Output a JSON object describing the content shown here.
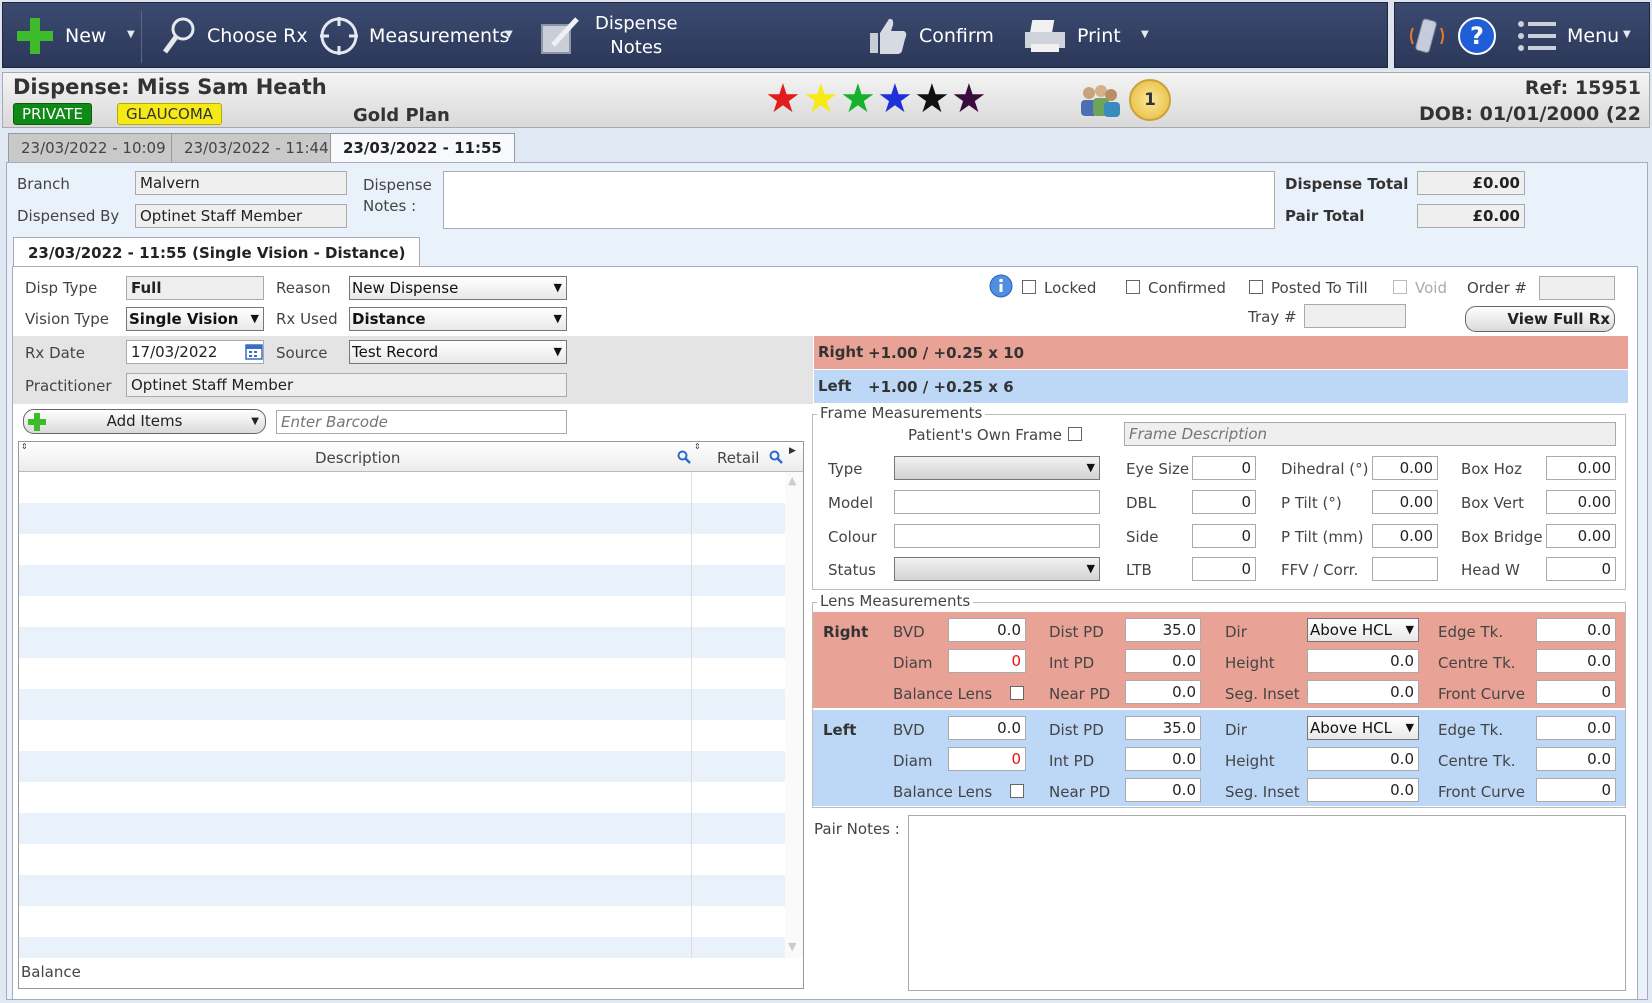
{
  "toolbar": {
    "new_label": "New",
    "choose_rx_label": "Choose Rx",
    "measurements_label": "Measurements",
    "dispense_notes_line1": "Dispense",
    "dispense_notes_line2": "Notes",
    "confirm_label": "Confirm",
    "print_label": "Print",
    "menu_label": "Menu"
  },
  "header": {
    "title": "Dispense: Miss Sam Heath",
    "tag_private": "PRIVATE",
    "tag_glaucoma": "GLAUCOMA",
    "plan": "Gold Plan",
    "badge_count": "1",
    "ref": "Ref: 15951",
    "dob": "DOB: 01/01/2000 (22",
    "star_colors": [
      "#e21b1b",
      "#f5ea16",
      "#17b22c",
      "#1f2fd9",
      "#111111",
      "#3b0b3d"
    ]
  },
  "tabs": [
    "23/03/2022 - 10:09",
    "23/03/2022 - 11:44",
    "23/03/2022 - 11:55"
  ],
  "summary": {
    "branch_label": "Branch",
    "branch_value": "Malvern",
    "dispensed_by_label": "Dispensed By",
    "dispensed_by_value": "Optinet Staff Member",
    "notes_label_1": "Dispense",
    "notes_label_2": "Notes :",
    "dispense_total_label": "Dispense Total",
    "dispense_total_value": "£0.00",
    "pair_total_label": "Pair Total",
    "pair_total_value": "£0.00"
  },
  "pair_tab": "23/03/2022 - 11:55 (Single Vision - Distance)",
  "pair": {
    "disp_type_label": "Disp Type",
    "disp_type_value": "Full",
    "reason_label": "Reason",
    "reason_value": "New Dispense",
    "vision_type_label": "Vision Type",
    "vision_type_value": "Single Vision",
    "rx_used_label": "Rx Used",
    "rx_used_value": "Distance",
    "rx_date_label": "Rx Date",
    "rx_date_value": "17/03/2022",
    "source_label": "Source",
    "source_value": "Test Record",
    "practitioner_label": "Practitioner",
    "practitioner_value": "Optinet Staff Member",
    "locked_label": "Locked",
    "confirmed_label": "Confirmed",
    "posted_label": "Posted To Till",
    "void_label": "Void",
    "order_label": "Order #",
    "tray_label": "Tray #",
    "view_full_rx": "View Full Rx",
    "rx_right_label": "Right",
    "rx_right_value": "+1.00 / +0.25 x 10",
    "rx_left_label": "Left",
    "rx_left_value": "+1.00 / +0.25 x 6",
    "add_items": "Add Items",
    "barcode_placeholder": "Enter Barcode",
    "col_description": "Description",
    "col_retail": "Retail",
    "balance_label": "Balance",
    "pair_notes_label": "Pair Notes :"
  },
  "frame": {
    "legend": "Frame Measurements",
    "own_frame_label": "Patient's Own Frame",
    "frame_desc_placeholder": "Frame Description",
    "type_label": "Type",
    "model_label": "Model",
    "colour_label": "Colour",
    "status_label": "Status",
    "eye_size_label": "Eye Size",
    "eye_size": "0",
    "dbl_label": "DBL",
    "dbl": "0",
    "side_label": "Side",
    "side": "0",
    "ltb_label": "LTB",
    "ltb": "0",
    "dihedral_label": "Dihedral (°)",
    "dihedral": "0.00",
    "ptilt_label": "P Tilt (°)",
    "ptilt": "0.00",
    "ptilt_mm_label": "P Tilt (mm)",
    "ptilt_mm": "0.00",
    "ffv_label": "FFV / Corr.",
    "box_hoz_label": "Box Hoz",
    "box_hoz": "0.00",
    "box_vert_label": "Box Vert",
    "box_vert": "0.00",
    "box_bridge_label": "Box Bridge",
    "box_bridge": "0.00",
    "head_w_label": "Head W",
    "head_w": "0"
  },
  "lens": {
    "legend": "Lens Measurements",
    "bvd_label": "BVD",
    "diam_label": "Diam",
    "balance_label": "Balance Lens",
    "dist_pd_label": "Dist PD",
    "int_pd_label": "Int PD",
    "near_pd_label": "Near PD",
    "dir_label": "Dir",
    "height_label": "Height",
    "seg_inset_label": "Seg. Inset",
    "edge_label": "Edge Tk.",
    "centre_label": "Centre Tk.",
    "front_label": "Front Curve",
    "right": {
      "label": "Right",
      "bvd": "0.0",
      "diam": "0",
      "dist_pd": "35.0",
      "int_pd": "0.0",
      "near_pd": "0.0",
      "dir": "Above HCL",
      "height": "0.0",
      "seg_inset": "0.0",
      "edge": "0.0",
      "centre": "0.0",
      "front": "0"
    },
    "left": {
      "label": "Left",
      "bvd": "0.0",
      "diam": "0",
      "dist_pd": "35.0",
      "int_pd": "0.0",
      "near_pd": "0.0",
      "dir": "Above HCL",
      "height": "0.0",
      "seg_inset": "0.0",
      "edge": "0.0",
      "centre": "0.0",
      "front": "0"
    }
  }
}
